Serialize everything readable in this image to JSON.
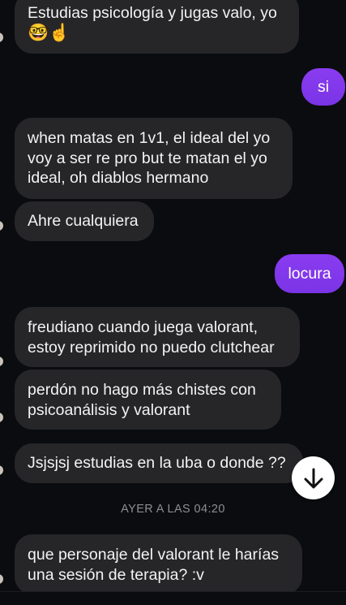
{
  "messages": [
    {
      "type": "received",
      "lines": [
        "Estudias psicología y jugas valo, yo",
        "🤓☝️"
      ]
    },
    {
      "type": "sent",
      "text": "si"
    },
    {
      "type": "received",
      "lines": [
        "when matas en 1v1, el ideal del yo",
        "voy a ser re pro but te matan el yo",
        "ideal, oh diablos hermano"
      ]
    },
    {
      "type": "received",
      "lines": [
        "Ahre cualquiera"
      ]
    },
    {
      "type": "sent",
      "text": "locura"
    },
    {
      "type": "received",
      "lines": [
        "freudiano cuando juega valorant,",
        "estoy reprimido no puedo clutchear"
      ]
    },
    {
      "type": "received",
      "lines": [
        "perdón no hago más chistes con",
        "psicoanálisis y valorant"
      ]
    },
    {
      "type": "received",
      "lines": [
        "Jsjsjsj estudias en la uba o donde ??"
      ]
    },
    {
      "type": "received",
      "lines": [
        "que personaje del valorant le harías",
        "una sesión de terapia? :v"
      ]
    }
  ],
  "timestamp_divider": "AYER A LAS 04:20",
  "scroll_button": {
    "icon": "arrow-down-icon"
  },
  "colors": {
    "background": "#0b0c0f",
    "received_bubble": "#262629",
    "sent_bubble": "#7c3aed",
    "divider_text": "#8d8e93"
  }
}
